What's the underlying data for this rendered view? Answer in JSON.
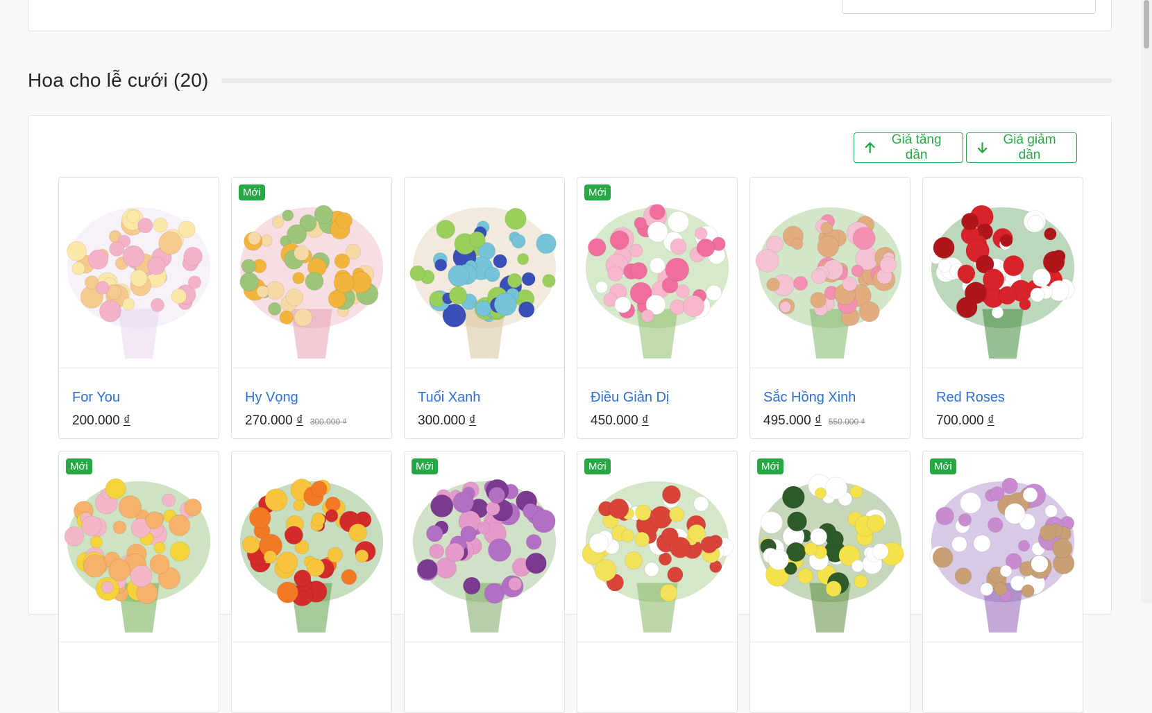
{
  "section": {
    "title": "Hoa cho lễ cưới (20)"
  },
  "sort": {
    "asc_label": "Giá tăng dần",
    "desc_label": "Giá giảm dần"
  },
  "products": [
    {
      "name": "For You",
      "price": "200.000",
      "currency": "₫",
      "old_price": "",
      "badge": "",
      "palette": [
        "#f3b2c8",
        "#f6c98e",
        "#fbe7a8",
        "#e7d6ef"
      ]
    },
    {
      "name": "Hy Vọng",
      "price": "270.000",
      "currency": "₫",
      "old_price": "300.000 ₫",
      "badge": "Mới",
      "palette": [
        "#f2b43a",
        "#f7d9a6",
        "#9cc57a",
        "#e8a0b0"
      ]
    },
    {
      "name": "Tuổi Xanh",
      "price": "300.000",
      "currency": "₫",
      "old_price": "",
      "badge": "",
      "palette": [
        "#9bcf5b",
        "#3a4fb8",
        "#74c3d9",
        "#d9c29c"
      ]
    },
    {
      "name": "Điều Giản Dị",
      "price": "450.000",
      "currency": "₫",
      "old_price": "",
      "badge": "Mới",
      "palette": [
        "#f06e9e",
        "#f7b7cd",
        "#ffffff",
        "#8cbf6a"
      ]
    },
    {
      "name": "Sắc Hồng Xinh",
      "price": "495.000",
      "currency": "₫",
      "old_price": "550.000 ₫",
      "badge": "",
      "palette": [
        "#f48fb1",
        "#f5c2d3",
        "#e1ad7f",
        "#7fb767"
      ]
    },
    {
      "name": "Red Roses",
      "price": "700.000",
      "currency": "₫",
      "old_price": "",
      "badge": "",
      "palette": [
        "#d8232a",
        "#b0151b",
        "#ffffff",
        "#3f8b3d"
      ]
    },
    {
      "name": "",
      "price": "",
      "currency": "",
      "old_price": "",
      "badge": "Mới",
      "palette": [
        "#f5d33a",
        "#f6b16b",
        "#f3b7c8",
        "#6fae4e"
      ]
    },
    {
      "name": "",
      "price": "",
      "currency": "",
      "old_price": "",
      "badge": "",
      "palette": [
        "#f27a24",
        "#d32a2a",
        "#f7c43c",
        "#5f9e49"
      ]
    },
    {
      "name": "",
      "price": "",
      "currency": "",
      "old_price": "",
      "badge": "Mới",
      "palette": [
        "#b36fc4",
        "#e49bc9",
        "#7a3a8f",
        "#7aa860"
      ]
    },
    {
      "name": "",
      "price": "",
      "currency": "",
      "old_price": "",
      "badge": "Mới",
      "palette": [
        "#f4e15a",
        "#ffffff",
        "#d9443a",
        "#88b763"
      ]
    },
    {
      "name": "",
      "price": "",
      "currency": "",
      "old_price": "",
      "badge": "Mới",
      "palette": [
        "#f5e24a",
        "#2e5a2a",
        "#ffffff",
        "#5f8c3e"
      ]
    },
    {
      "name": "",
      "price": "",
      "currency": "",
      "old_price": "",
      "badge": "Mới",
      "palette": [
        "#c98bd0",
        "#ffffff",
        "#c8a074",
        "#8f63b8"
      ]
    }
  ]
}
